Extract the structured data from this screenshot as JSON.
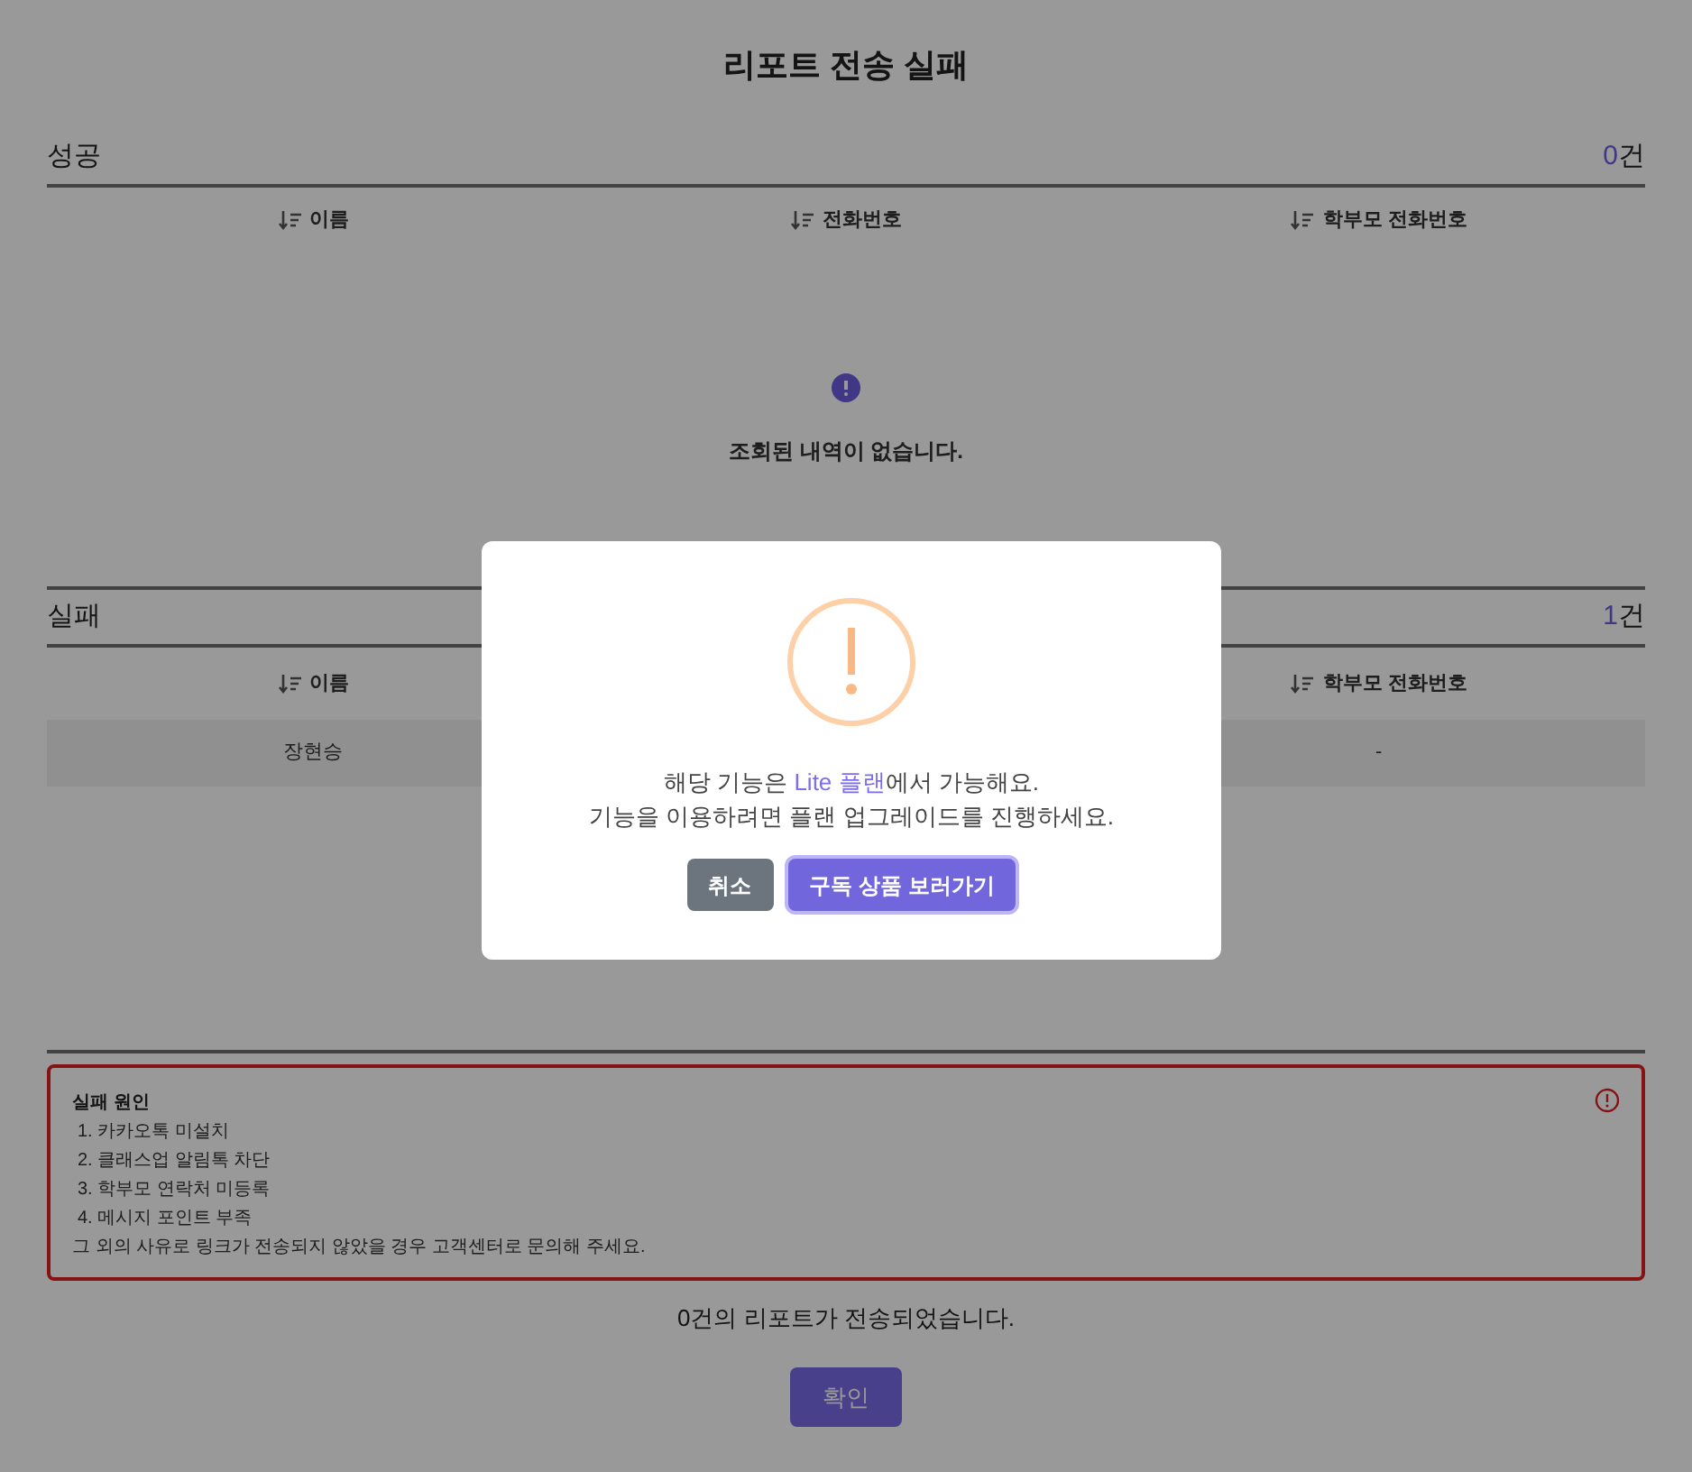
{
  "title": "리포트 전송 실패",
  "success": {
    "label": "성공",
    "count": "0",
    "unit": "건",
    "columns": [
      "이름",
      "전화번호",
      "학부모 전화번호"
    ],
    "empty_message": "조회된 내역이 없습니다."
  },
  "failure": {
    "label": "실패",
    "count": "1",
    "unit": "건",
    "columns": [
      "이름",
      "학부모 전화번호"
    ],
    "rows": [
      {
        "cells": [
          "장현승",
          "-"
        ]
      }
    ]
  },
  "reasons": {
    "title": "실패 원인",
    "items": [
      "1. 카카오톡 미설치",
      "2. 클래스업 알림톡 차단",
      "3. 학부모 연락처 미등록",
      "4. 메시지 포인트 부족"
    ],
    "note": "그 외의 사유로 링크가 전송되지 않았을 경우 고객센터로 문의해 주세요."
  },
  "summary": "0건의 리포트가 전송되었습니다.",
  "confirm_button": "확인",
  "dialog": {
    "line_1": "해당 기능은 **Lite 플랜**에서 가능해요.",
    "line_2": "기능을 이용하려면 플랜 업그레이드를 진행하세요.",
    "buttons": [
      {
        "kind": "secondary",
        "label": "취소"
      },
      {
        "kind": "primary",
        "label": "구독 상품 보러가기"
      }
    ]
  }
}
